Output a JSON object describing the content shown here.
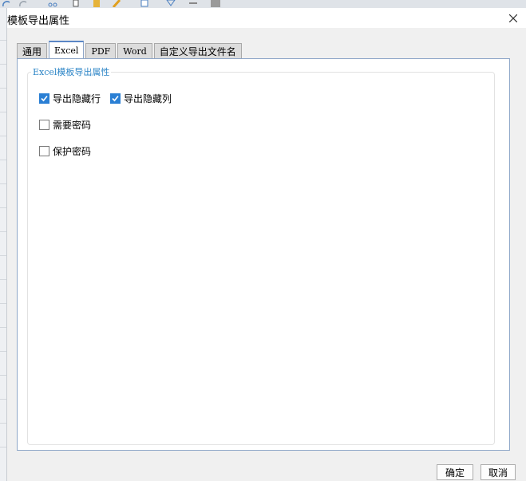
{
  "dialog": {
    "title": "模板导出属性"
  },
  "tabs": [
    {
      "label": "通用"
    },
    {
      "label": "Excel"
    },
    {
      "label": "PDF"
    },
    {
      "label": "Word"
    },
    {
      "label": "自定义导出文件名"
    }
  ],
  "active_tab": "Excel",
  "group": {
    "title": "Excel模板导出属性"
  },
  "options": {
    "export_hidden_rows": {
      "label": "导出隐藏行",
      "checked": true
    },
    "export_hidden_cols": {
      "label": "导出隐藏列",
      "checked": true
    },
    "require_password": {
      "label": "需要密码",
      "checked": false
    },
    "protect_password": {
      "label": "保护密码",
      "checked": false
    }
  },
  "buttons": {
    "ok": "确定",
    "cancel": "取消"
  },
  "colors": {
    "accent": "#2a7fd4",
    "group_title": "#2b84c6",
    "tab_border_active": "#5b86c5"
  }
}
